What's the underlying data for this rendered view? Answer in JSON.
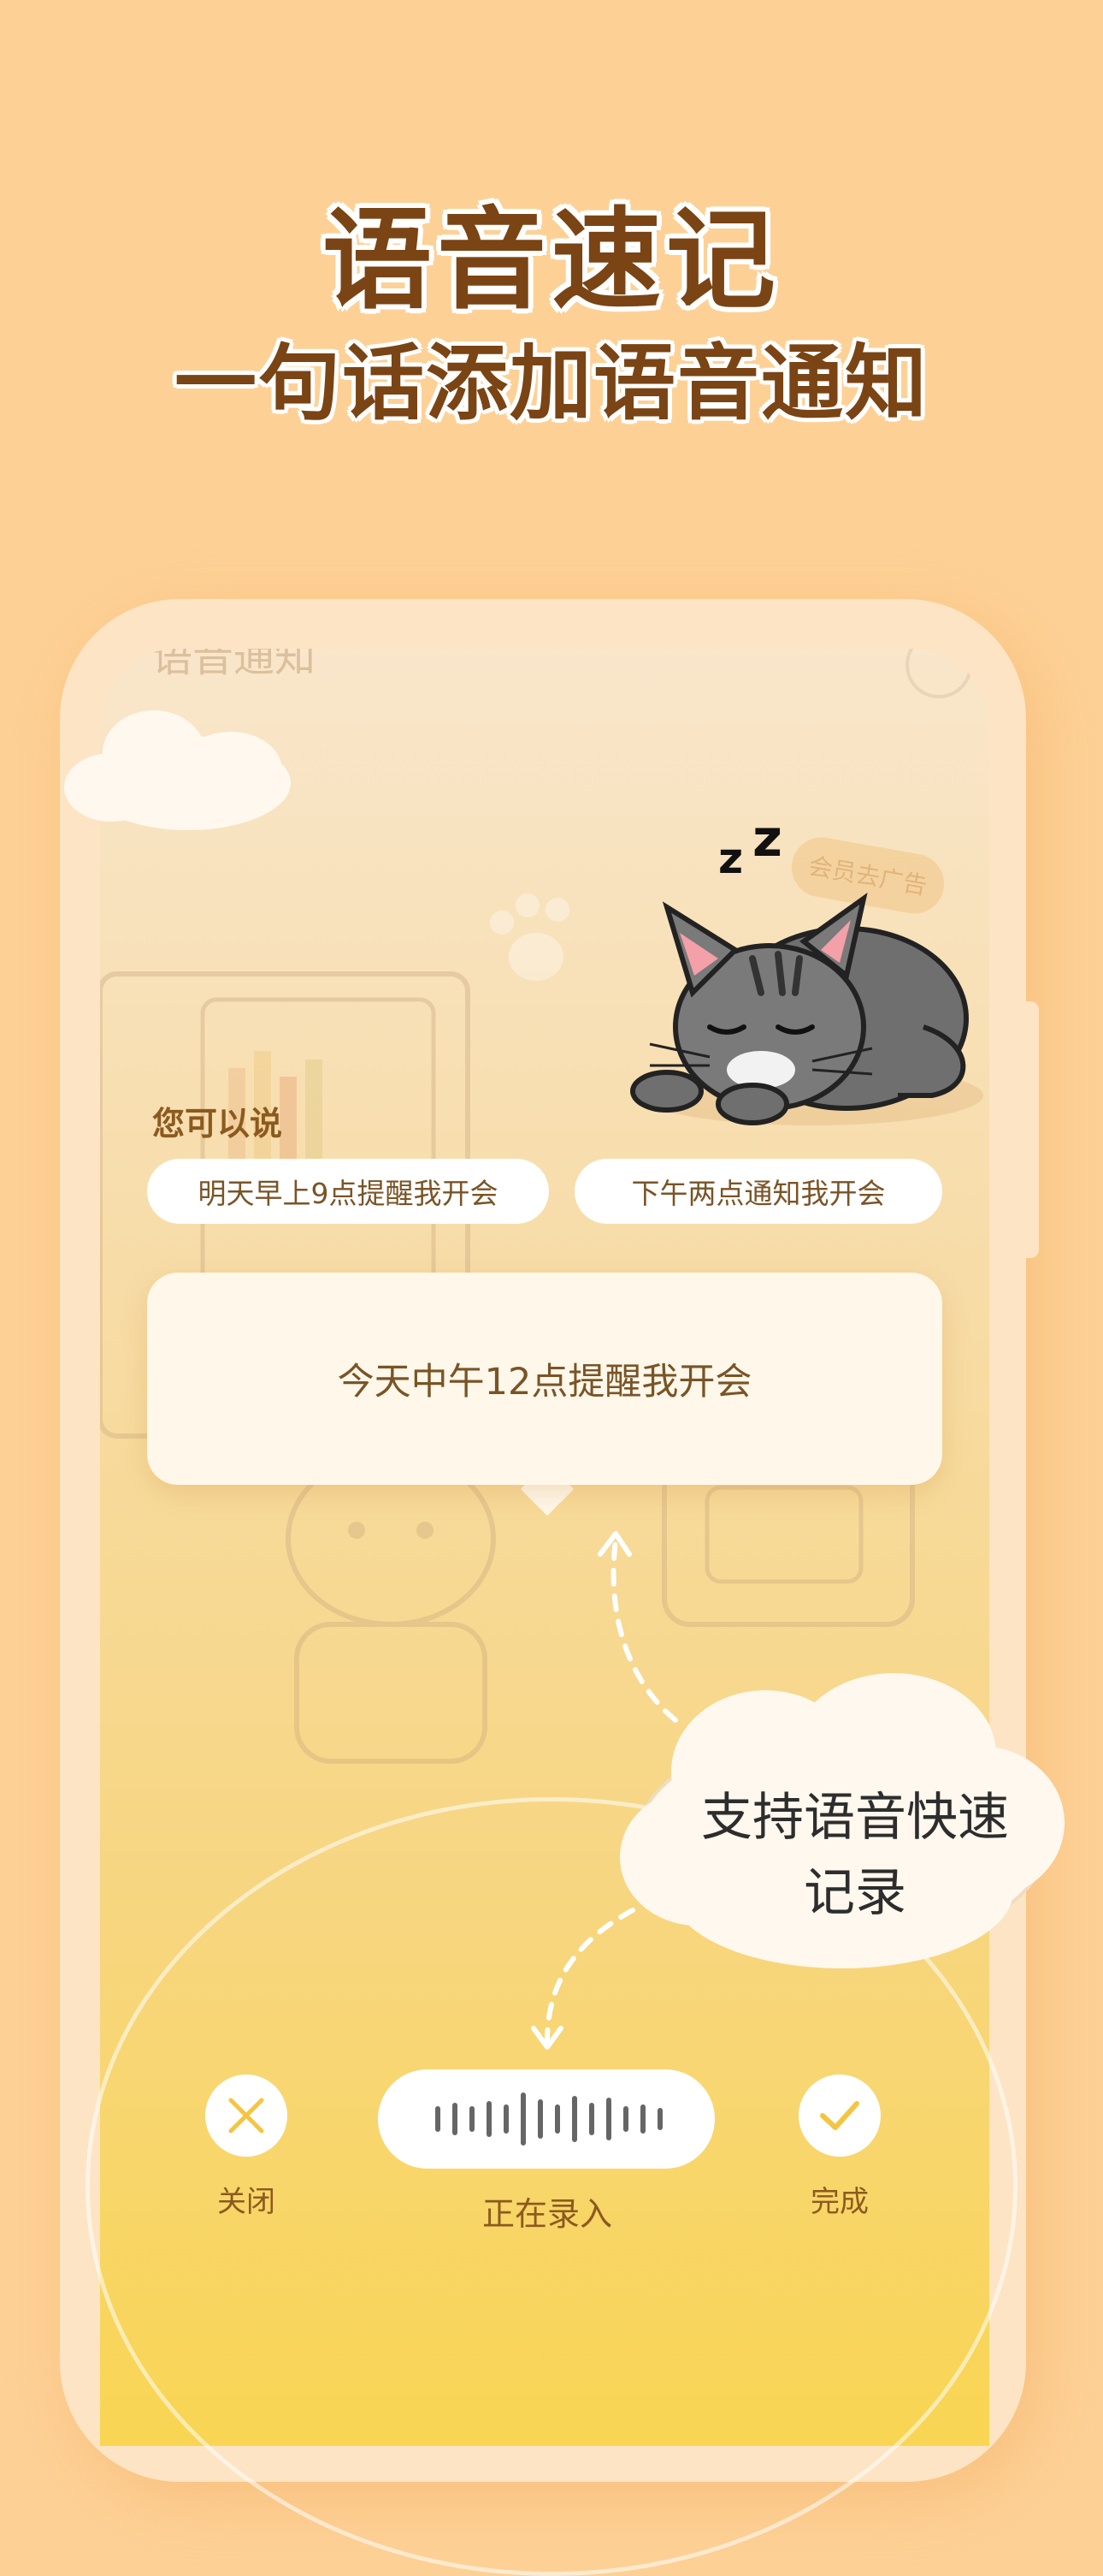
{
  "headline": {
    "title": "语音速记",
    "subtitle": "一句话添加语音通知"
  },
  "screen": {
    "title": "语音通知",
    "vip_badge": "会员去广告",
    "prompt_label": "您可以说",
    "suggestions": [
      "明天早上9点提醒我开会",
      "下午两点通知我开会"
    ],
    "recognized_text": "今天中午12点提醒我开会",
    "callout": {
      "line1": "支持语音快速",
      "line2": "记录"
    },
    "controls": {
      "close_label": "关闭",
      "recording_label": "正在录入",
      "done_label": "完成"
    }
  },
  "colors": {
    "background": "#fdd196",
    "headline_text": "#7a4414",
    "accent_yellow": "#f5c542",
    "label_brown": "#8c5a1f"
  },
  "icons": [
    "close-x-icon",
    "check-icon",
    "waveform-icon",
    "sleeping-cat-illustration",
    "cloud-illustration",
    "paw-print-icon"
  ]
}
